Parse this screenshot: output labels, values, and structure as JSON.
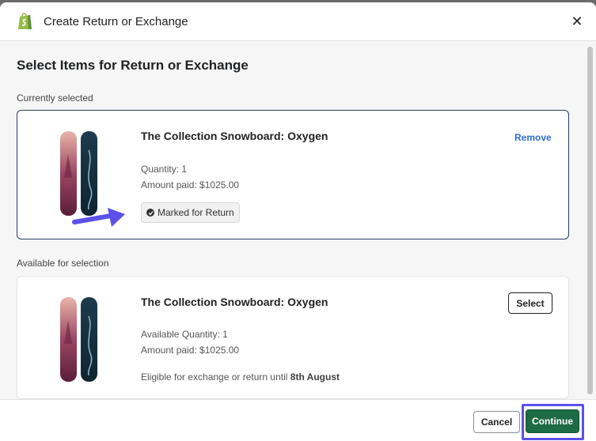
{
  "modal": {
    "title": "Create Return or Exchange",
    "close_icon": "close-icon",
    "logo_icon": "shopify-bag-icon"
  },
  "body": {
    "heading": "Select Items for Return or Exchange",
    "currently_selected_label": "Currently selected",
    "available_label": "Available for selection"
  },
  "selected_item": {
    "title": "The Collection Snowboard: Oxygen",
    "quantity": "Quantity: 1",
    "amount_paid": "Amount paid: $1025.00",
    "badge": "Marked for Return",
    "remove_label": "Remove",
    "image_name": "snowboard-image"
  },
  "available_item": {
    "title": "The Collection Snowboard: Oxygen",
    "quantity": "Available Quantity: 1",
    "amount_paid": "Amount paid: $1025.00",
    "eligibility_prefix": "Eligible for exchange or return until ",
    "eligibility_date": "8th August",
    "select_label": "Select",
    "image_name": "snowboard-image"
  },
  "footer": {
    "cancel_label": "Cancel",
    "continue_label": "Continue"
  },
  "colors": {
    "primary_button": "#1e6b45",
    "highlight": "#5b50e8",
    "link": "#2c6ecb",
    "selected_border": "#2c3a62"
  }
}
